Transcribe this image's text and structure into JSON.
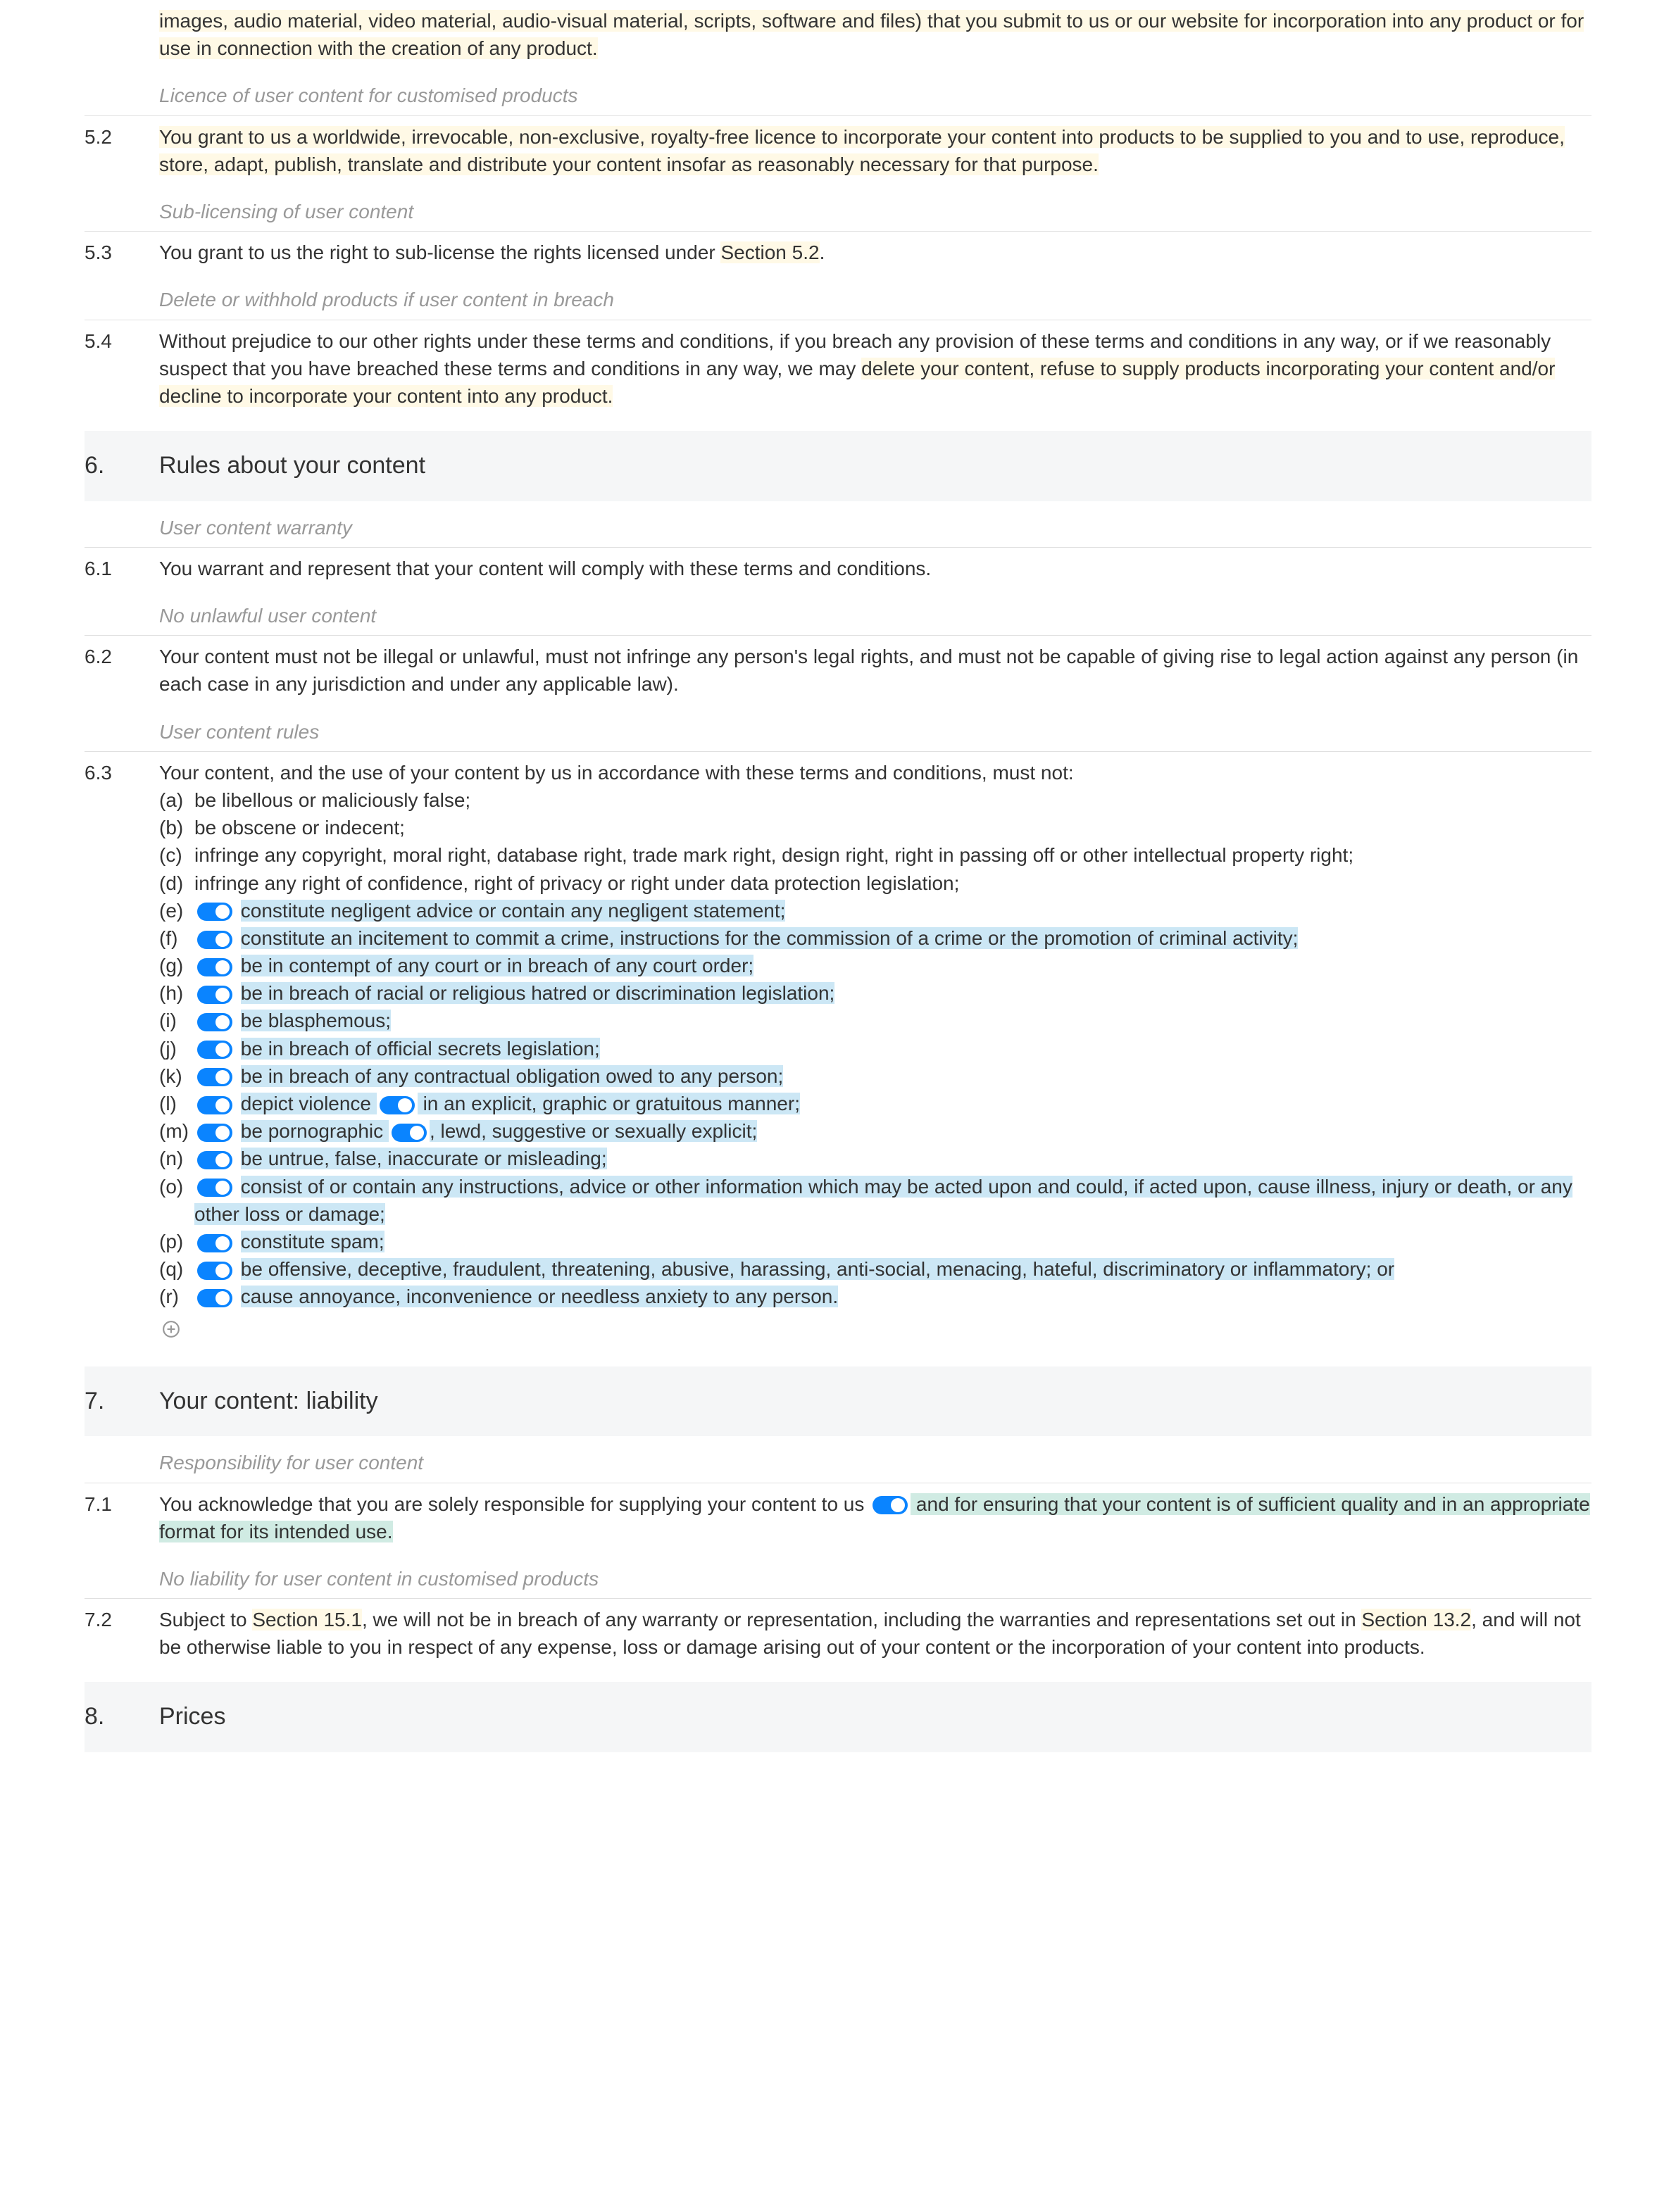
{
  "intro": "images, audio material, video material, audio-visual material, scripts, software and files) that you submit to us or our website for incorporation into any product or for use in connection with the creation of any product.",
  "sub52head": "Licence of user content for customised products",
  "c52num": "5.2",
  "c52": "You grant to us a worldwide, irrevocable, non-exclusive, royalty-free licence to incorporate your content into products to be supplied to you and to use, reproduce, store, adapt, publish, translate and distribute your content insofar as reasonably necessary for that purpose.",
  "sub53head": "Sub-licensing of user content",
  "c53num": "5.3",
  "c53a": "You grant to us the right to sub-license the rights licensed under ",
  "c53b": "Section 5.2",
  "c53c": ".",
  "sub54head": "Delete or withhold products if user content in breach",
  "c54num": "5.4",
  "c54a": "Without prejudice to our other rights under these terms and conditions, if you breach any provision of these terms and conditions in any way, or if we reasonably suspect that you have breached these terms and conditions in any way, we may ",
  "c54b": "delete your content, refuse to supply products incorporating your content and/or decline to incorporate your content into any product.",
  "s6num": "6.",
  "s6title": "Rules about your content",
  "sub61head": "User content warranty",
  "c61num": "6.1",
  "c61": "You warrant and represent that your content will comply with these terms and conditions.",
  "sub62head": "No unlawful user content",
  "c62num": "6.2",
  "c62": "Your content must not be illegal or unlawful, must not infringe any person's legal rights, and must not be capable of giving rise to legal action against any person (in each case in any jurisdiction and under any applicable law).",
  "sub63head": "User content rules",
  "c63num": "6.3",
  "c63intro": "Your content, and the use of your content by us in accordance with these terms and conditions, must not:",
  "la": "(a)",
  "ta": "be libellous or maliciously false;",
  "lb": "(b)",
  "tb": "be obscene or indecent;",
  "lc": "(c)",
  "tc": "infringe any copyright, moral right, database right, trade mark right, design right, right in passing off or other intellectual property right;",
  "ld": "(d)",
  "td": "infringe any right of confidence, right of privacy or right under data protection legislation;",
  "le": "(e)",
  "te": "constitute negligent advice or contain any negligent statement;",
  "lf": "(f)",
  "tf": "constitute an incitement to commit a crime, instructions for the commission of a crime or the promotion of criminal activity;",
  "lg": "(g)",
  "tg": "be in contempt of any court or in breach of any court order;",
  "lh": "(h)",
  "th": "be in breach of racial or religious hatred or discrimination legislation;",
  "li": "(i)",
  "ti": "be blasphemous;",
  "lj": "(j)",
  "tj": "be in breach of official secrets legislation;",
  "lk": "(k)",
  "tk": "be in breach of any contractual obligation owed to any person;",
  "ll": "(l)",
  "tl1": "depict violence ",
  "tl2": " in an explicit, graphic or gratuitous manner;",
  "lm": "(m)",
  "tm1": "be pornographic ",
  "tm2": ", lewd, suggestive or sexually explicit;",
  "ln": "(n)",
  "tn": "be untrue, false, inaccurate or misleading;",
  "lo": "(o)",
  "to": "consist of or contain any instructions, advice or other information which may be acted upon and could, if acted upon, cause illness, injury or death, or any other loss or damage;",
  "lp": "(p)",
  "tp": "constitute spam;",
  "lq": "(q)",
  "tq": "be offensive, deceptive, fraudulent, threatening, abusive, harassing, anti-social, menacing, hateful, discriminatory or inflammatory; or",
  "lr": "(r)",
  "tr": "cause annoyance, inconvenience or needless anxiety to any person.",
  "s7num": "7.",
  "s7title": "Your content: liability",
  "sub71head": "Responsibility for user content",
  "c71num": "7.1",
  "c71a": "You acknowledge that you are solely responsible for supplying your content to us ",
  "c71b": " and for ensuring that your content is of sufficient quality and in an appropriate format for its intended use.",
  "sub72head": "No liability for user content in customised products",
  "c72num": "7.2",
  "c72a": "Subject to ",
  "c72b": "Section 15.1",
  "c72c": ", we will not be in breach of any warranty or representation, including the warranties and representations set out in ",
  "c72d": "Section 13.2",
  "c72e": ", and will not be otherwise liable to you in respect of any expense, loss or damage arising out of your content or the incorporation of your content into products.",
  "s8num": "8.",
  "s8title": "Prices"
}
